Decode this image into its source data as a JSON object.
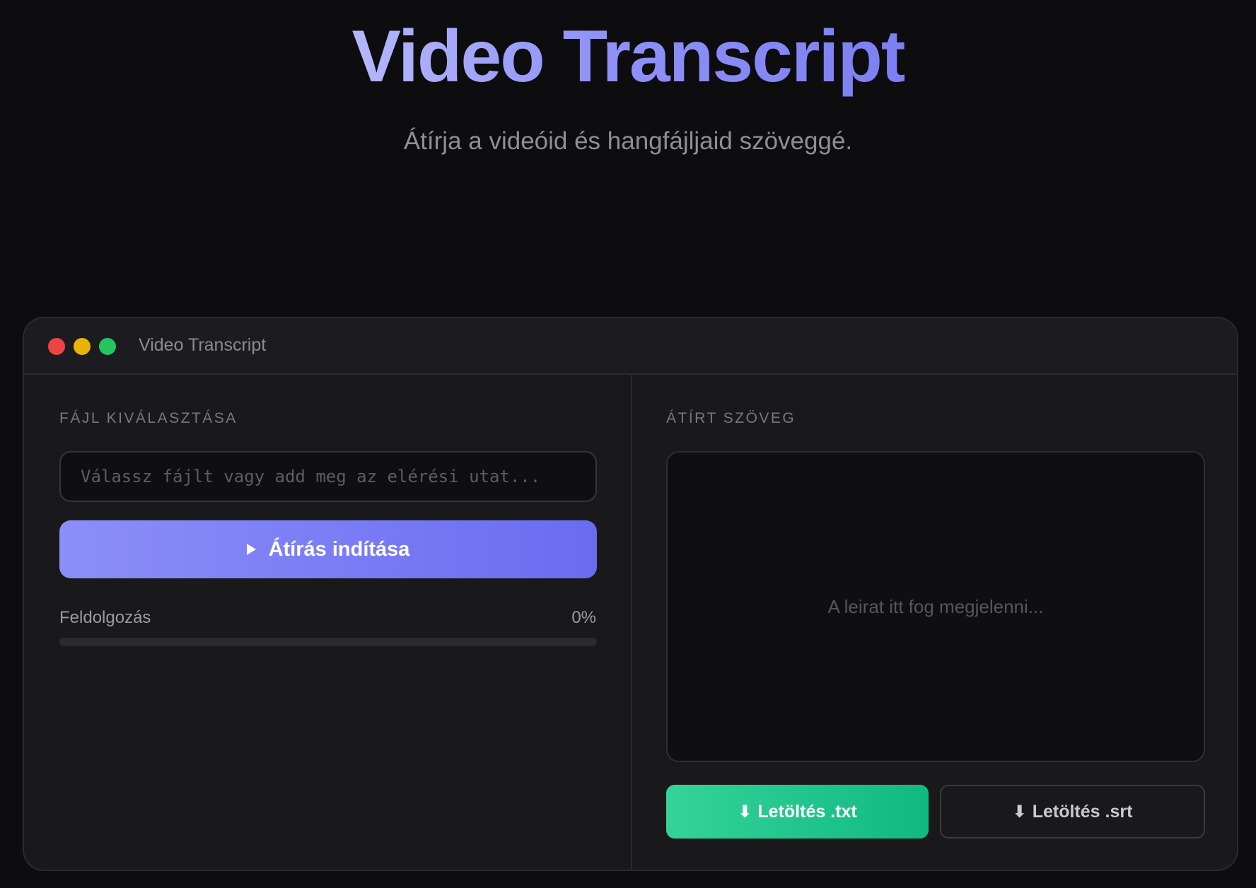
{
  "hero": {
    "title": "Video Transcript",
    "subtitle": "Átírja a videóid és hangfájljaid szöveggé."
  },
  "window": {
    "title": "Video Transcript",
    "controls": [
      "close",
      "minimize",
      "maximize"
    ]
  },
  "left_panel": {
    "section_label": "FÁJL KIVÁLASZTÁSA",
    "file_input": {
      "value": "",
      "placeholder": "Válassz fájlt vagy add meg az elérési utat..."
    },
    "start_button": {
      "icon": "play-icon",
      "label": "Átírás indítása"
    },
    "progress": {
      "label": "Feldolgozás",
      "value_text": "0%",
      "value": 0
    }
  },
  "right_panel": {
    "section_label": "ÁTÍRT SZÖVEG",
    "transcript_placeholder": "A leirat itt fog megjelenni...",
    "download_txt": {
      "icon": "⬇",
      "label": "Letöltés .txt"
    },
    "download_srt": {
      "icon": "⬇",
      "label": "Letöltés .srt"
    }
  },
  "colors": {
    "accent": "#7c7ff2",
    "success": "#10b981",
    "background": "#0d0d10",
    "window": "#19191c"
  }
}
